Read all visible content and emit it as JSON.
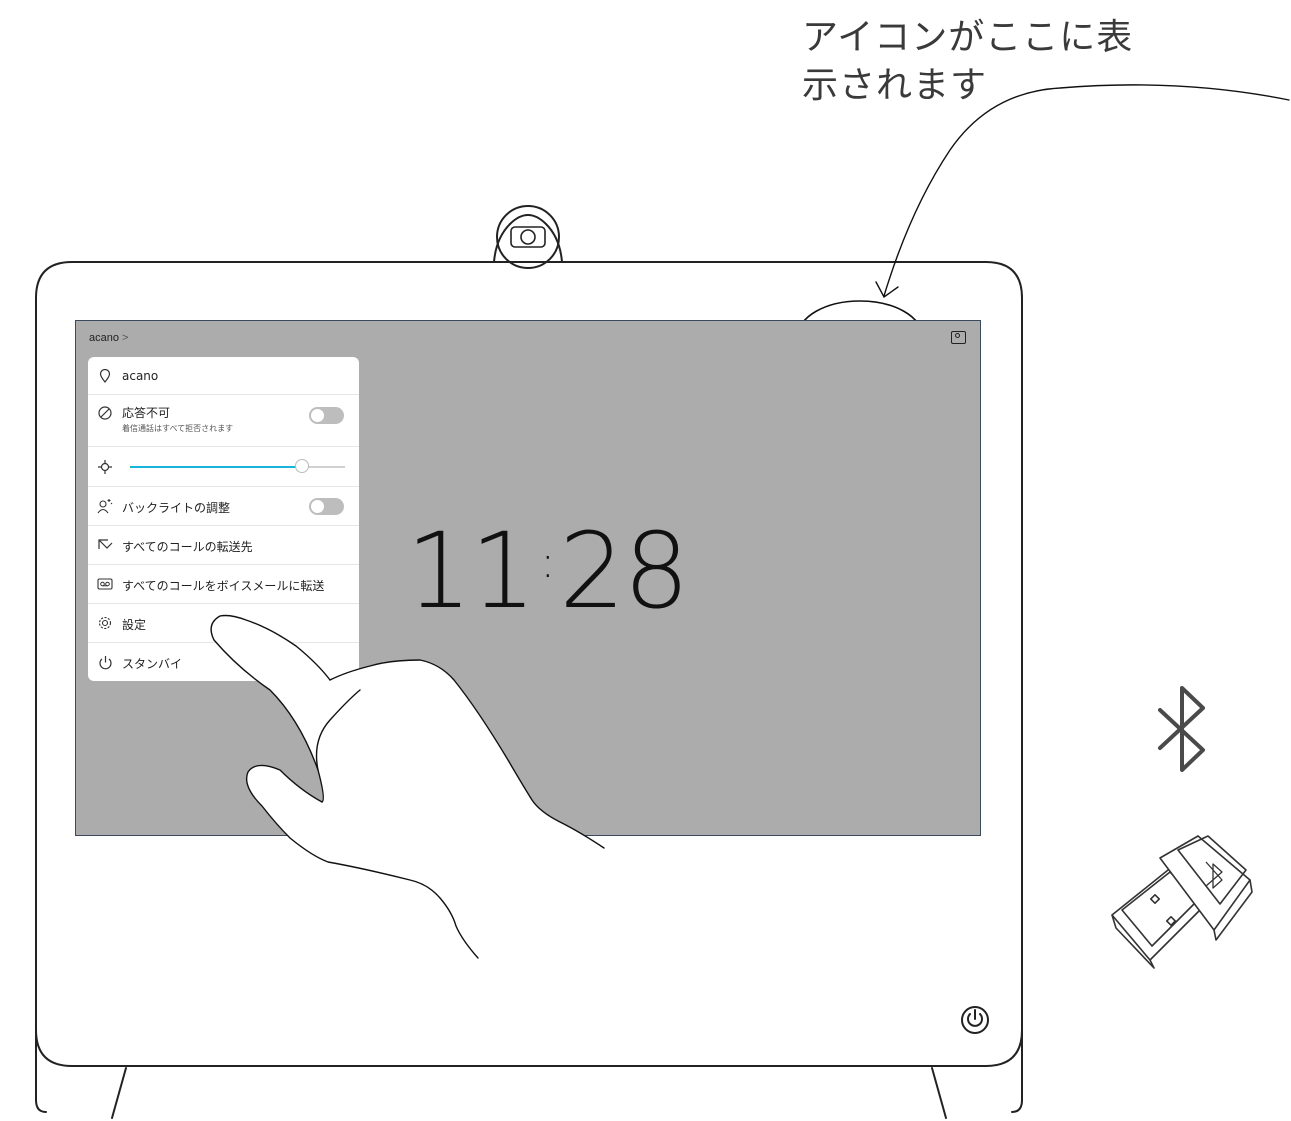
{
  "callout": {
    "line1": "アイコンがここに表",
    "line2": "示されます"
  },
  "screen": {
    "breadcrumb": "acano",
    "breadcrumb_chevron": ">",
    "clock": {
      "hours": "11",
      "minutes": "28"
    },
    "menu": {
      "location": {
        "label": "acano",
        "icon": "location-pin-icon"
      },
      "dnd": {
        "label": "応答不可",
        "sublabel": "着信通話はすべて拒否されます",
        "icon": "do-not-disturb-icon",
        "toggle_on": false
      },
      "brightness": {
        "icon": "brightness-icon",
        "level": 0.8
      },
      "backlight": {
        "label": "バックライトの調整",
        "icon": "backlight-icon",
        "toggle_on": false
      },
      "forward_all": {
        "label": "すべてのコールの転送先",
        "icon": "call-forward-icon"
      },
      "voicemail": {
        "label": "すべてのコールをボイスメールに転送",
        "icon": "voicemail-icon"
      },
      "settings": {
        "label": "設定",
        "icon": "gear-icon"
      },
      "standby": {
        "label": "スタンバイ",
        "icon": "power-icon"
      }
    }
  },
  "colors": {
    "screen_bg": "#acacac",
    "slider_accent": "#19b5d8",
    "line": "#222222"
  },
  "icons": [
    "camera-icon",
    "bluetooth-icon",
    "usb-bluetooth-dongle-icon",
    "power-button-icon",
    "self-view-icon",
    "hand-pointer-icon"
  ]
}
